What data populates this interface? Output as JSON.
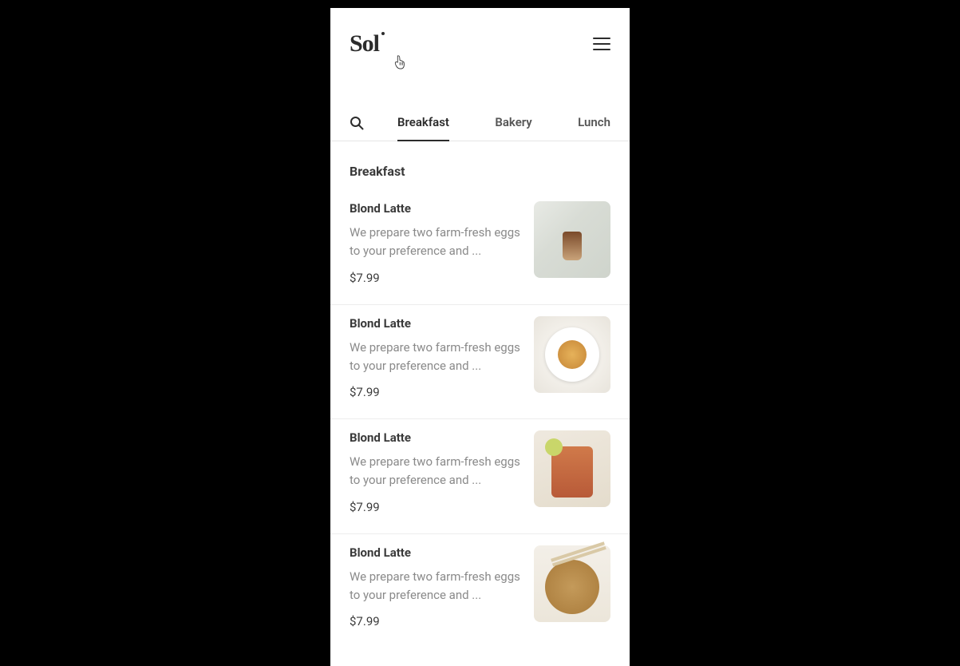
{
  "brand": "Sol",
  "tabs": [
    {
      "label": "Breakfast",
      "active": true
    },
    {
      "label": "Bakery",
      "active": false
    },
    {
      "label": "Lunch",
      "active": false
    }
  ],
  "section_title": "Breakfast",
  "items": [
    {
      "title": "Blond Latte",
      "desc": "We prepare two farm-fresh eggs to your preference and ...",
      "price": "$7.99"
    },
    {
      "title": "Blond Latte",
      "desc": "We prepare two farm-fresh eggs to your preference and ...",
      "price": "$7.99"
    },
    {
      "title": "Blond Latte",
      "desc": "We prepare two farm-fresh eggs to your preference and ...",
      "price": "$7.99"
    },
    {
      "title": "Blond Latte",
      "desc": "We prepare two farm-fresh eggs to your preference and ...",
      "price": "$7.99"
    }
  ]
}
